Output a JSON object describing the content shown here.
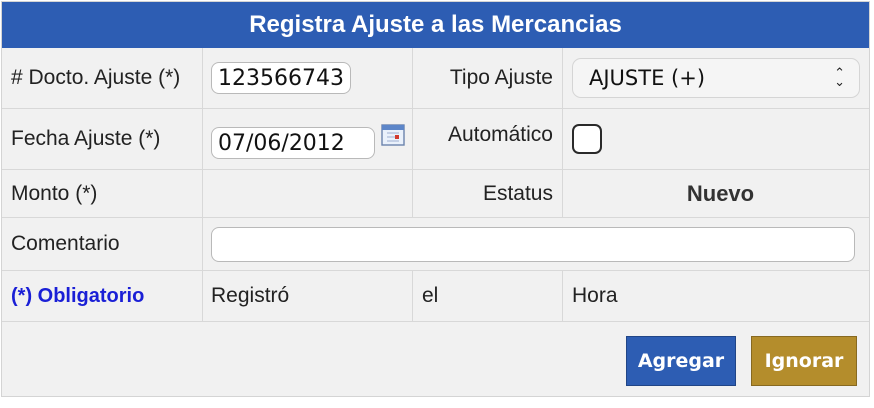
{
  "title": "Registra Ajuste a las Mercancias",
  "fields": {
    "docto_label": "# Docto. Ajuste (*)",
    "docto_value": "123566743",
    "tipo_label": "Tipo Ajuste",
    "tipo_value": "AJUSTE (+)",
    "fecha_label": "Fecha Ajuste (*)",
    "fecha_value": "07/06/2012",
    "automatico_label": "Automático",
    "monto_label": "Monto (*)",
    "estatus_label": "Estatus",
    "estatus_value": "Nuevo",
    "comentario_label": "Comentario",
    "comentario_value": ""
  },
  "footer_row": {
    "required_note": "(*) Obligatorio",
    "registro_label": "Registró",
    "el_label": "el",
    "hora_label": "Hora"
  },
  "buttons": {
    "add_label": "Agregar",
    "ignore_label": "Ignorar"
  },
  "colors": {
    "header_bg": "#2d5db3",
    "add_button": "#2d5db3",
    "ignore_button": "#b48d2c",
    "required_text": "#1a1fd6"
  },
  "icons": {
    "calendar": "calendar-icon",
    "select_arrows": "chevron-updown-icon"
  }
}
